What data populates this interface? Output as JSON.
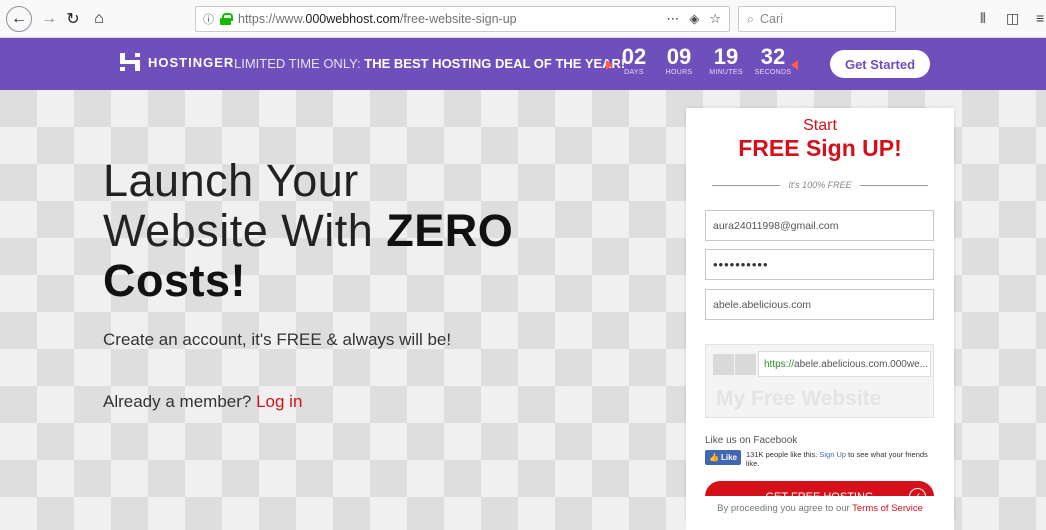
{
  "browser": {
    "url_prefix": "https://www.",
    "url_domain": "000webhost.com",
    "url_path": "/free-website-sign-up",
    "search_placeholder": "Cari"
  },
  "promo": {
    "brand": "HOSTINGER",
    "text_prefix": "LIMITED TIME ONLY:",
    "text_bold": "THE BEST HOSTING DEAL OF THE YEAR!",
    "countdown": [
      {
        "value": "02",
        "label": "DAYS"
      },
      {
        "value": "09",
        "label": "HOURS"
      },
      {
        "value": "19",
        "label": "MINUTES"
      },
      {
        "value": "32",
        "label": "SECONDS"
      }
    ],
    "cta": "Get Started"
  },
  "hero": {
    "line1": "Launch Your",
    "line2": "Website With ",
    "line2_bold": "ZERO",
    "line3_bold": "Costs!",
    "subhead": "Create an account, it's FREE & always will be!",
    "member_text": "Already a member? ",
    "login_link": "Log in"
  },
  "signup": {
    "start": "Start",
    "title": "FREE Sign UP!",
    "tagline": "It's 100% FREE",
    "email": "aura24011998@gmail.com",
    "password_mask": "••••••••••",
    "site_name": "abele.abelicious.com",
    "preview_url_scheme": "https://",
    "preview_url_rest": "abele.abelicious.com.000we...",
    "preview_ghost": "My Free Website",
    "facebook_title": "Like us on Facebook",
    "like_label": "Like",
    "fb_text_1": "131K people like this. ",
    "fb_signup": "Sign Up",
    "fb_text_2": " to see what your friends like.",
    "submit": "GET FREE HOSTING",
    "terms_prefix": "By proceeding you agree to our ",
    "terms_link": "Terms of Service"
  }
}
